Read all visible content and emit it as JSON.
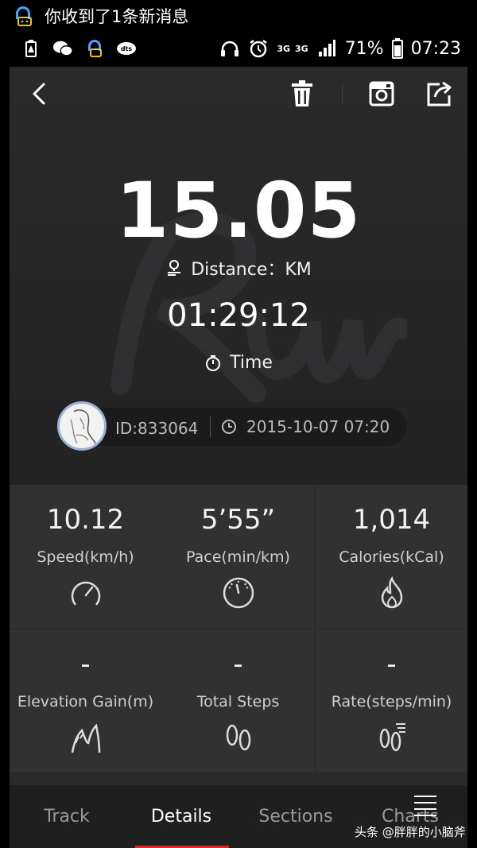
{
  "notification": {
    "text": "你收到了1条新消息",
    "icon": "chat-bot-icon"
  },
  "status_bar": {
    "signal_1": "3G",
    "signal_2": "3G",
    "battery": "71%",
    "clock": "07:23"
  },
  "run": {
    "distance": "15.05",
    "distance_label": "Distance：KM",
    "time": "01:29:12",
    "time_label": "Time",
    "user_id": "ID:833064",
    "datetime": "2015-10-07 07:20"
  },
  "stats": [
    {
      "value": "10.12",
      "label": "Speed(km/h)",
      "icon": "speedometer-icon"
    },
    {
      "value": "5’55”",
      "label": "Pace(min/km)",
      "icon": "gauge-icon"
    },
    {
      "value": "1,014",
      "label": "Calories(kCal)",
      "icon": "flame-icon"
    },
    {
      "value": "-",
      "label": "Elevation Gain(m)",
      "icon": "elevation-icon"
    },
    {
      "value": "-",
      "label": "Total Steps",
      "icon": "footprints-icon"
    },
    {
      "value": "-",
      "label": "Rate(steps/min)",
      "icon": "step-rate-icon"
    }
  ],
  "tabs": [
    {
      "label": "Track",
      "active": false
    },
    {
      "label": "Details",
      "active": true
    },
    {
      "label": "Sections",
      "active": false
    },
    {
      "label": "Charts",
      "active": false
    }
  ],
  "watermark": "头条 @胖胖的小脑斧",
  "colors": {
    "accent": "#e2232a",
    "background": "#262627",
    "text": "#ffffff"
  }
}
